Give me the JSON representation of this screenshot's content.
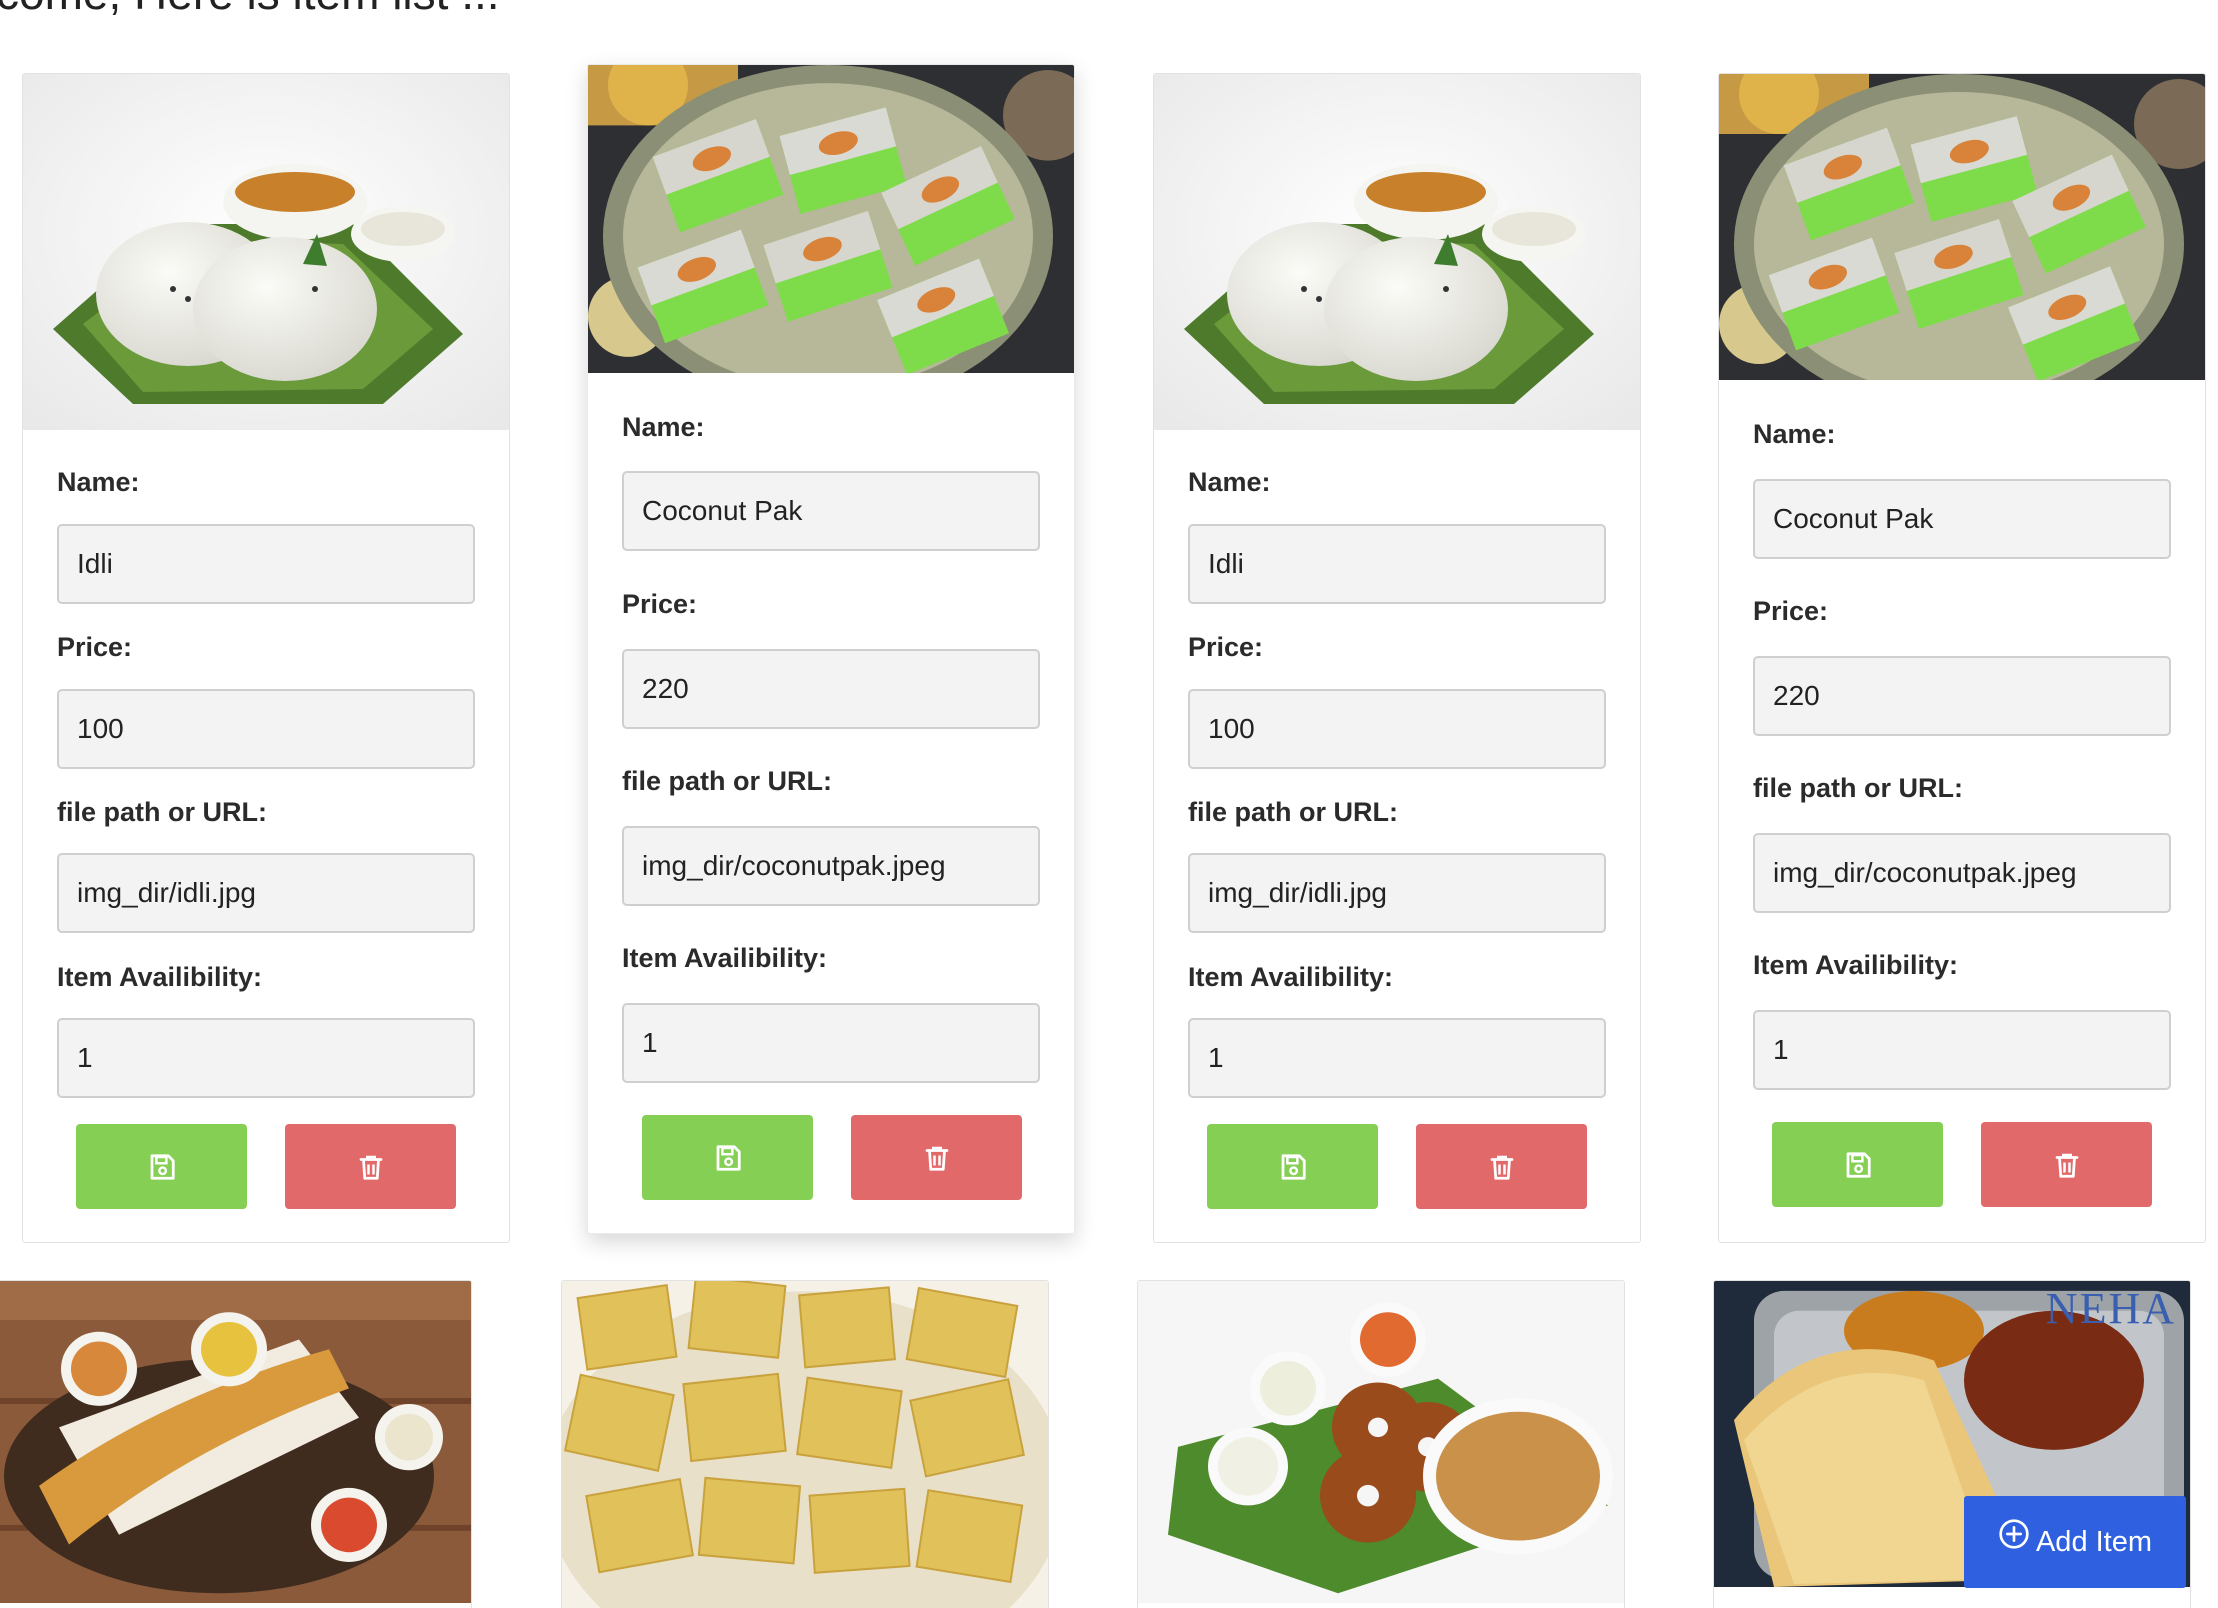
{
  "page": {
    "heading": "come, Here is item list ..."
  },
  "labels": {
    "name": "Name:",
    "price": "Price:",
    "path": "file path or URL:",
    "availability": "Item Availibility:"
  },
  "items": [
    {
      "name": "Idli",
      "price": "100",
      "path": "img_dir/idli.jpg",
      "availability": "1",
      "image": "idli"
    },
    {
      "name": "Coconut Pak",
      "price": "220",
      "path": "img_dir/coconutpak.jpeg",
      "availability": "1",
      "image": "coconut-pak"
    },
    {
      "name": "Idli",
      "price": "100",
      "path": "img_dir/idli.jpg",
      "availability": "1",
      "image": "idli"
    },
    {
      "name": "Coconut Pak",
      "price": "220",
      "path": "img_dir/coconutpak.jpeg",
      "availability": "1",
      "image": "coconut-pak"
    }
  ],
  "next_row_images": [
    "masala-dosa",
    "dhokla",
    "medu-vada",
    "dosa-thali"
  ],
  "watermark": "NEHA",
  "actions": {
    "add_item_label": "Add Item"
  },
  "icons": {
    "save": "floppy-disk-icon",
    "delete": "trash-icon",
    "add": "plus-circle-icon"
  },
  "colors": {
    "save": "#86cf55",
    "delete": "#e2696a",
    "add": "#2e60e0"
  }
}
